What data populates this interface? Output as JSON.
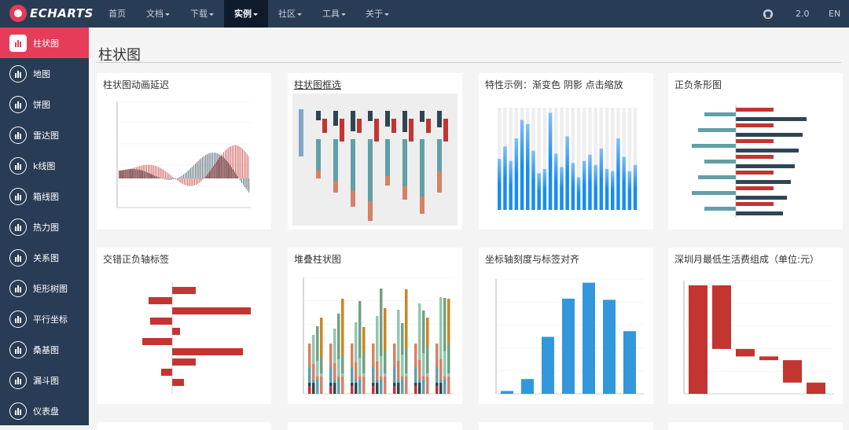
{
  "topnav": {
    "logo": "ECHARTS",
    "items": [
      {
        "label": "首页",
        "caret": false
      },
      {
        "label": "文档",
        "caret": true
      },
      {
        "label": "下载",
        "caret": true
      },
      {
        "label": "实例",
        "caret": true,
        "active": true
      },
      {
        "label": "社区",
        "caret": true
      },
      {
        "label": "工具",
        "caret": true
      },
      {
        "label": "关于",
        "caret": true
      }
    ],
    "version": "2.0",
    "lang": "EN",
    "github_icon": "github-icon"
  },
  "sidebar": {
    "items": [
      {
        "label": "柱状图",
        "icon": "bar-chart-icon",
        "active": true
      },
      {
        "label": "地图",
        "icon": "map-icon"
      },
      {
        "label": "饼图",
        "icon": "pie-chart-icon"
      },
      {
        "label": "雷达图",
        "icon": "radar-chart-icon"
      },
      {
        "label": "k线图",
        "icon": "candlestick-icon"
      },
      {
        "label": "箱线图",
        "icon": "boxplot-icon"
      },
      {
        "label": "热力图",
        "icon": "heatmap-icon"
      },
      {
        "label": "关系图",
        "icon": "graph-icon"
      },
      {
        "label": "矩形树图",
        "icon": "treemap-icon"
      },
      {
        "label": "平行坐标",
        "icon": "parallel-icon"
      },
      {
        "label": "桑基图",
        "icon": "sankey-icon"
      },
      {
        "label": "漏斗图",
        "icon": "funnel-icon"
      },
      {
        "label": "仪表盘",
        "icon": "gauge-icon"
      }
    ]
  },
  "main": {
    "title": "柱状图",
    "cards": [
      {
        "title": "柱状图动画延迟"
      },
      {
        "title": "柱状图框选"
      },
      {
        "title": "特性示例：渐变色 阴影 点击缩放"
      },
      {
        "title": "正负条形图"
      },
      {
        "title": "交错正负轴标签"
      },
      {
        "title": "堆叠柱状图"
      },
      {
        "title": "坐标轴刻度与标签对齐"
      },
      {
        "title": "深圳月最低生活费组成（单位:元）"
      }
    ]
  },
  "colors": {
    "nav_bg": "#293c55",
    "nav_active": "#0d1b2b",
    "accent": "#e43c59",
    "bar_red": "#c23531",
    "bar_dark": "#2f4554",
    "bar_teal": "#61a0a8",
    "bar_orange": "#d48265",
    "bar_blue": "#3398db"
  }
}
